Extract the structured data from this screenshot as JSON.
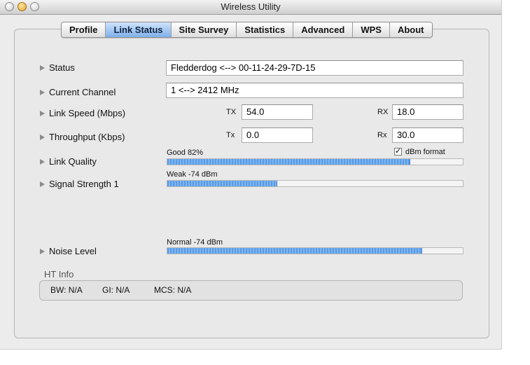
{
  "window": {
    "title": "Wireless Utility"
  },
  "tabs": [
    {
      "label": "Profile",
      "active": false
    },
    {
      "label": "Link Status",
      "active": true
    },
    {
      "label": "Site Survey",
      "active": false
    },
    {
      "label": "Statistics",
      "active": false
    },
    {
      "label": "Advanced",
      "active": false
    },
    {
      "label": "WPS",
      "active": false
    },
    {
      "label": "About",
      "active": false
    }
  ],
  "status": {
    "label": "Status",
    "value": "Fledderdog <--> 00-11-24-29-7D-15"
  },
  "channel": {
    "label": "Current Channel",
    "value": "1 <--> 2412 MHz"
  },
  "link_speed": {
    "label": "Link Speed (Mbps)",
    "tx_label": "TX",
    "tx_value": "54.0",
    "rx_label": "RX",
    "rx_value": "18.0"
  },
  "throughput": {
    "label": "Throughput (Kbps)",
    "tx_label": "Tx",
    "tx_value": "0.0",
    "rx_label": "Rx",
    "rx_value": "30.0"
  },
  "link_quality": {
    "label": "Link Quality",
    "caption": "Good 82%",
    "level": 0.82
  },
  "dbm_format": {
    "label": "dBm format",
    "checked": true
  },
  "signal_strength": {
    "label": "Signal Strength 1",
    "caption": "Weak -74 dBm",
    "level": 0.37
  },
  "noise_level": {
    "label": "Noise Level",
    "caption": "Normal -74 dBm",
    "level": 0.86
  },
  "ht_info": {
    "title": "HT Info",
    "bw": "BW: N/A",
    "gi": "GI: N/A",
    "mcs": "MCS: N/A"
  },
  "colors": {
    "accent": "#5a9be6",
    "tab_active": "#7fb0ea"
  }
}
